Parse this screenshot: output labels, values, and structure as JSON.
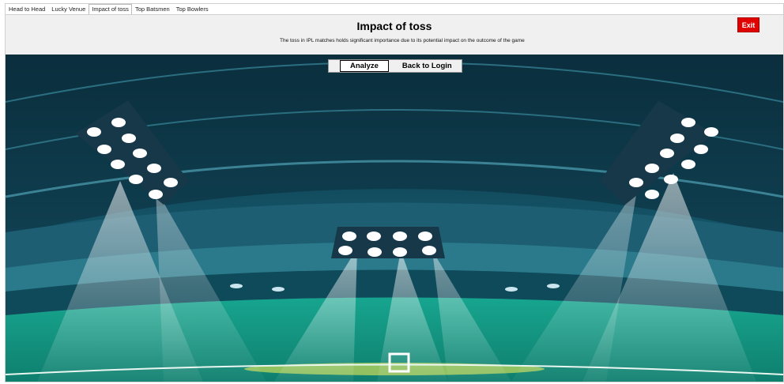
{
  "tabs": [
    {
      "label": "Head to Head",
      "active": false
    },
    {
      "label": "Lucky Venue",
      "active": false
    },
    {
      "label": "Impact of toss",
      "active": true
    },
    {
      "label": "Top Batsmen",
      "active": false
    },
    {
      "label": "Top Bowlers",
      "active": false
    }
  ],
  "header": {
    "title": "Impact of toss",
    "description": "The toss in IPL matches holds significant importance due to its potential impact on the outcome of the game",
    "exit_label": "Exit"
  },
  "actions": {
    "analyze_label": "Analyze",
    "back_label": "Back to Login"
  },
  "colors": {
    "exit_button": "#e00000",
    "header_bg": "#f0f0f0",
    "stadium_sky": "#0f3e4f",
    "pitch_green": "#1fb49a"
  },
  "background_image": "stadium-floodlights-illustration"
}
